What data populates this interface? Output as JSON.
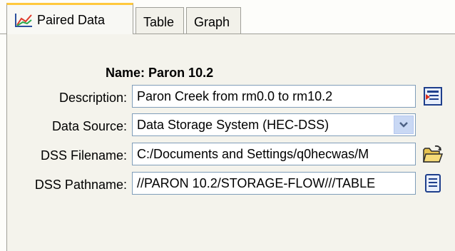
{
  "tabs": [
    {
      "label": "Paired Data",
      "active": true
    },
    {
      "label": "Table",
      "active": false
    },
    {
      "label": "Graph",
      "active": false
    }
  ],
  "form": {
    "name_label": "Name:",
    "name_value": "Paron 10.2",
    "description_label": "Description:",
    "description_value": "Paron Creek from rm0.0 to rm10.2",
    "data_source_label": "Data Source:",
    "data_source_value": "Data Storage System (HEC-DSS)",
    "dss_filename_label": "DSS Filename:",
    "dss_filename_value": "C:/Documents and Settings/q0hecwas/M",
    "dss_pathname_label": "DSS Pathname:",
    "dss_pathname_value": "//PARON 10.2/STORAGE-FLOW///TABLE"
  },
  "icons": {
    "tab_icon": "paired-data-graph-icon",
    "description_button": "edit-text-icon",
    "filename_button": "open-folder-icon",
    "pathname_button": "select-path-icon",
    "dropdown": "chevron-down-icon"
  },
  "colors": {
    "active_tab_accent": "#ffc83c",
    "panel_background": "#f4f3ec",
    "field_border": "#7f9db9",
    "dropdown_button": "#c9d8f4"
  }
}
